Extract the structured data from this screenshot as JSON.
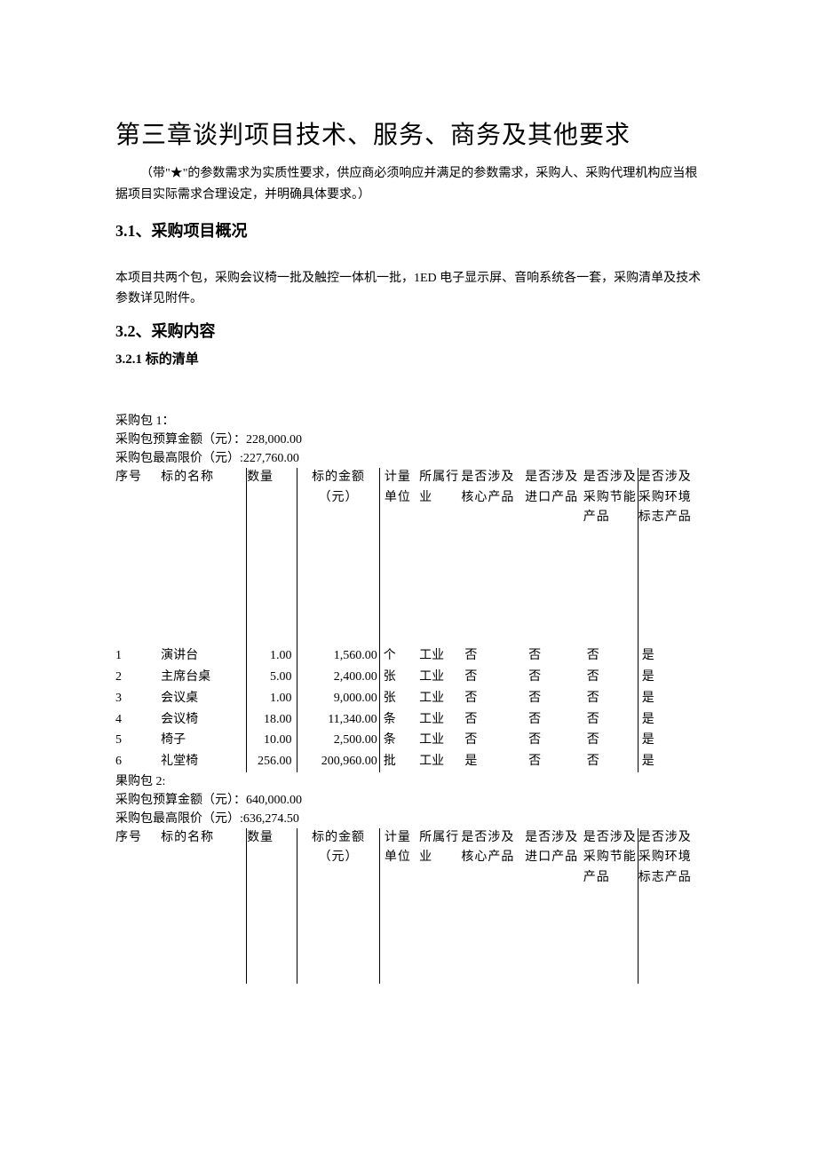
{
  "title": "第三章谈判项目技术、服务、商务及其他要求",
  "intro": "（带\"★\"的参数需求为实质性要求，供应商必须响应并满足的参数需求，采购人、采购代理机构应当根据项目实际需求合理设定，并明确具体要求。）",
  "sec31_heading": "3.1、采购项目概况",
  "sec31_body": "本项目共两个包，采购会议椅一批及触控一体机一批，1ED 电子显示屏、音响系统各一套，采购清单及技术参数详见附件。",
  "sec32_heading": "3.2、采购内容",
  "sec321_heading": "3.2.1  标的清单",
  "headers": {
    "seq": "序号",
    "name": "标的名称",
    "qty": "数量",
    "amount": "标的金额（元）",
    "unit": "计量单位",
    "industry": "所属行业",
    "core": "是否涉及核心产品",
    "import": "是否涉及进口产品",
    "energy": "是否涉及采购节能产品",
    "env": "是否涉及采购环境标志产品",
    "industry2": "所属行业"
  },
  "pkg1": {
    "label": "采购包 1：",
    "budget_label": "采购包预算金额（元）：",
    "budget": "228,000.00",
    "ceil_label": "采购包最高限价（元）:",
    "ceil": "227,760.00",
    "rows": [
      {
        "seq": "1",
        "name": "演讲台",
        "qty": "1.00",
        "amount": "1,560.00",
        "unit": "个",
        "industry": "工业",
        "core": "否",
        "import": "否",
        "energy": "否",
        "env": "是"
      },
      {
        "seq": "2",
        "name": "主席台桌",
        "qty": "5.00",
        "amount": "2,400.00",
        "unit": "张",
        "industry": "工业",
        "core": "否",
        "import": "否",
        "energy": "否",
        "env": "是"
      },
      {
        "seq": "3",
        "name": "会议桌",
        "qty": "1.00",
        "amount": "9,000.00",
        "unit": "张",
        "industry": "工业",
        "core": "否",
        "import": "否",
        "energy": "否",
        "env": "是"
      },
      {
        "seq": "4",
        "name": "会议椅",
        "qty": "18.00",
        "amount": "11,340.00",
        "unit": "条",
        "industry": "工业",
        "core": "否",
        "import": "否",
        "energy": "否",
        "env": "是"
      },
      {
        "seq": "5",
        "name": "椅子",
        "qty": "10.00",
        "amount": "2,500.00",
        "unit": "条",
        "industry": "工业",
        "core": "否",
        "import": "否",
        "energy": "否",
        "env": "是"
      },
      {
        "seq": "6",
        "name": "礼堂椅",
        "qty": "256.00",
        "amount": "200,960.00",
        "unit": "批",
        "industry": "工业",
        "core": "是",
        "import": "否",
        "energy": "否",
        "env": "是"
      }
    ]
  },
  "pkg2": {
    "label": "果购包 2:",
    "budget_label": "采购包预算金额（元）：",
    "budget": "640,000.00",
    "ceil_label": "采购包最高限价（元）:",
    "ceil": "636,274.50"
  }
}
